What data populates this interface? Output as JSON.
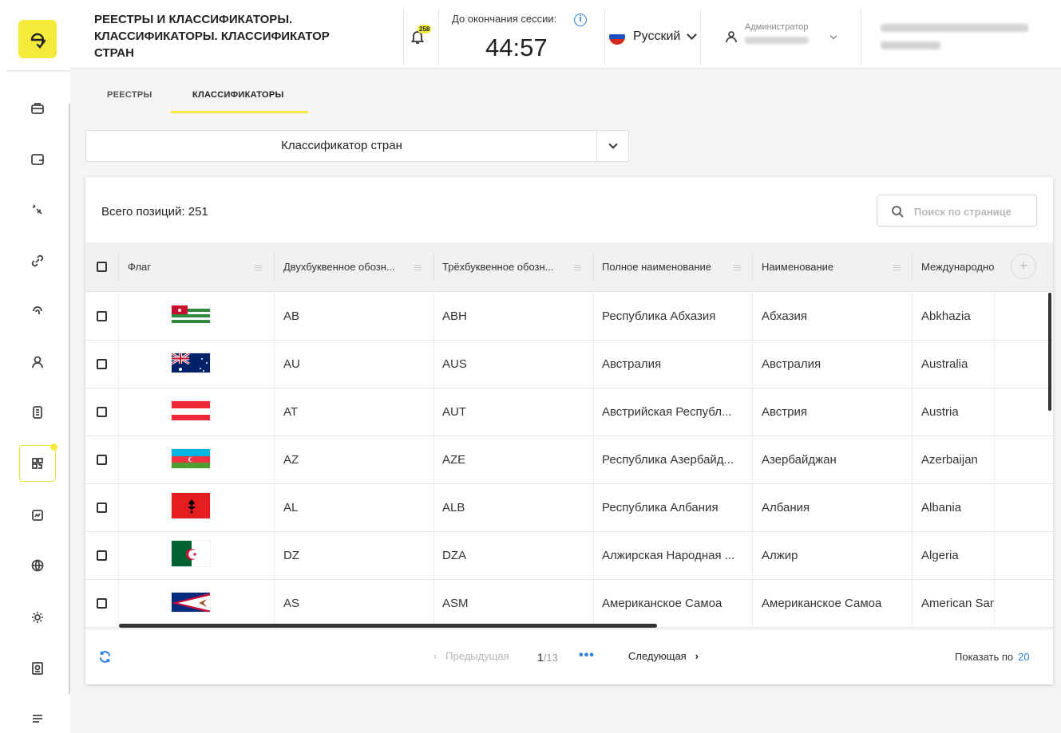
{
  "header": {
    "title": "РЕЕСТРЫ И КЛАССИФИКАТОРЫ. КЛАССИФИКАТОРЫ. КЛАССИФИКАТОР СТРАН",
    "notifications_count": "258",
    "session_label": "До окончания сессии:",
    "session_timer": "44:57",
    "language": "Русский",
    "user_role": "Администратор"
  },
  "tabs": [
    {
      "label": "РЕЕСТРЫ",
      "active": false
    },
    {
      "label": "КЛАССИФИКАТОРЫ",
      "active": true
    }
  ],
  "classifier_select": {
    "value": "Классификатор стран"
  },
  "table": {
    "total_label": "Всего позиций: 251",
    "search_placeholder": "Поиск по странице",
    "columns": [
      "Флаг",
      "Двухбуквенное обозн...",
      "Трёхбуквенное обозн...",
      "Полное наименование",
      "Наименование",
      "Международное"
    ],
    "rows": [
      {
        "flag": "abkhazia",
        "alpha2": "AB",
        "alpha3": "ABH",
        "full_name": "Республика Абхазия",
        "name": "Абхазия",
        "intl": "Abkhazia"
      },
      {
        "flag": "australia",
        "alpha2": "AU",
        "alpha3": "AUS",
        "full_name": "Австралия",
        "name": "Австралия",
        "intl": "Australia"
      },
      {
        "flag": "austria",
        "alpha2": "AT",
        "alpha3": "AUT",
        "full_name": "Австрийская Республ...",
        "name": "Австрия",
        "intl": "Austria"
      },
      {
        "flag": "azerbaijan",
        "alpha2": "AZ",
        "alpha3": "AZE",
        "full_name": "Республика Азербайд...",
        "name": "Азербайджан",
        "intl": "Azerbaijan"
      },
      {
        "flag": "albania",
        "alpha2": "AL",
        "alpha3": "ALB",
        "full_name": "Республика Албания",
        "name": "Албания",
        "intl": "Albania"
      },
      {
        "flag": "algeria",
        "alpha2": "DZ",
        "alpha3": "DZA",
        "full_name": "Алжирская Народная ...",
        "name": "Алжир",
        "intl": "Algeria"
      },
      {
        "flag": "american-samoa",
        "alpha2": "AS",
        "alpha3": "ASM",
        "full_name": "Американское Самоа",
        "name": "Американское Самоа",
        "intl": "American Samoa"
      }
    ]
  },
  "pagination": {
    "prev_label": "Предыдущая",
    "current_page": "1",
    "total_pages": "/13",
    "more": "•••",
    "next_label": "Следующая",
    "per_page_label": "Показать по",
    "per_page_value": "20"
  },
  "colors": {
    "accent_yellow": "#f3ea3c",
    "link_blue": "#2a7de1"
  },
  "icons": [
    "logo-icon",
    "briefcase-icon",
    "wallet-icon",
    "pill-icon",
    "link-icon",
    "fingerprint-icon",
    "user-icon",
    "document-icon",
    "qr-code-icon",
    "chart-icon",
    "globe-icon",
    "settings-icon",
    "passport-icon",
    "menu-icon",
    "bell-icon",
    "info-icon",
    "chevron-down-icon",
    "search-icon",
    "add-column-icon",
    "refresh-icon"
  ]
}
